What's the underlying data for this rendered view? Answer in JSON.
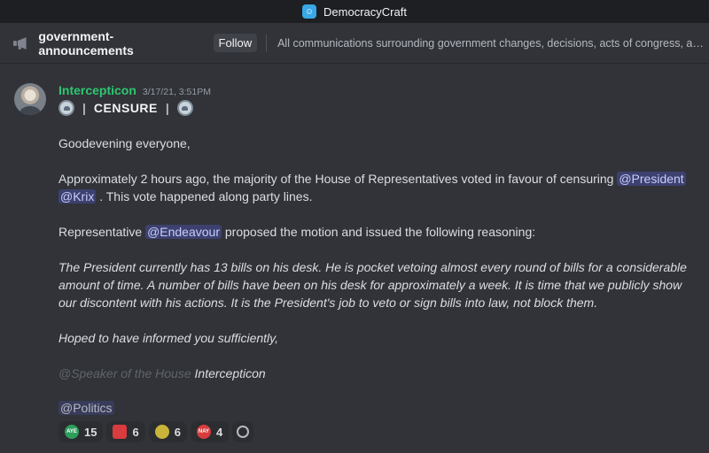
{
  "app": {
    "title": "DemocracyCraft"
  },
  "channel": {
    "name": "government-announcements",
    "follow_label": "Follow",
    "topic": "All communications surrounding government changes, decisions, acts of congress, and or ..."
  },
  "message": {
    "author": "Intercepticon",
    "timestamp": "3/17/21, 3:51PM",
    "title_word": "CENSURE",
    "pipe": "|",
    "greeting": "Goodevening everyone,",
    "p1_text": "Approximately 2 hours ago, the majority of the House of Representatives voted in favour of censuring ",
    "mention_president": "@President",
    "mention_krix": "@Krix",
    "p1_tail": " . This vote happened along party lines.",
    "p2_text": "Representative ",
    "mention_endeavour": "@Endeavour",
    "p2_tail": " proposed the motion and issued the following reasoning:",
    "quote": "The President currently has 13 bills on his desk. He is pocket vetoing almost every round of bills for a considerable amount of time. A number of bills have been on his desk for approximately a week. It is time that we publicly show our discontent with his actions. It is the President's job to veto or sign bills into law, not block them.",
    "closing": "Hoped to have informed you sufficiently,",
    "signature_role": "@Speaker of the House",
    "signature_name": "Intercepticon",
    "mention_politics": "@Politics"
  },
  "reactions": [
    {
      "icon": "aye-icon",
      "label": "AYE",
      "count": "15",
      "color": "#2e9e5b"
    },
    {
      "icon": "angry-face-icon",
      "label": "",
      "count": "6",
      "color": "#d83c3e"
    },
    {
      "icon": "thinking-face-icon",
      "label": "",
      "count": "6",
      "color": "#c9b43a"
    },
    {
      "icon": "nay-icon",
      "label": "NAY",
      "count": "4",
      "color": "#d83c3e"
    }
  ]
}
